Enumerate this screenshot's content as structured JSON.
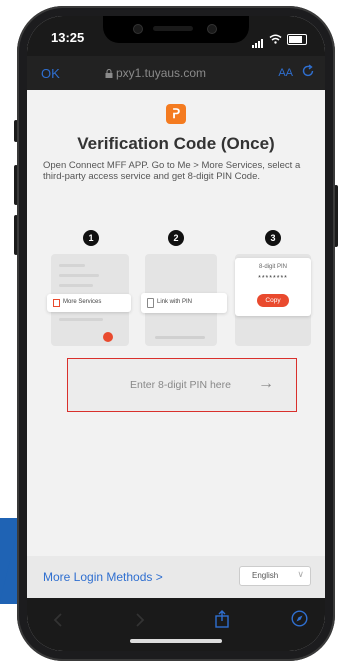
{
  "status_bar": {
    "time": "13:25"
  },
  "browser": {
    "left_label": "OK",
    "url": "pxy1.tuyaus.com",
    "text_size_label": "AA",
    "reload_icon": "reload-icon"
  },
  "page": {
    "logo_text": "ᕈ",
    "title": "Verification Code (Once)",
    "description": "Open Connect MFF APP. Go to Me > More Services, select a third-party access service and get 8-digit PIN Code.",
    "steps": [
      {
        "number": "1",
        "label": "More Services"
      },
      {
        "number": "2",
        "label": "Link with PIN"
      },
      {
        "number": "3",
        "label": "8-digit PIN",
        "value": "********",
        "button": "Copy"
      }
    ],
    "pin_input": {
      "placeholder": "Enter 8-digit PIN here",
      "arrow": "→"
    },
    "more_login": "More Login Methods >",
    "language": {
      "selected": "English",
      "chevron": "∨"
    }
  },
  "toolbar": {
    "back_icon": "back-icon",
    "forward_icon": "forward-icon",
    "share_icon": "share-icon",
    "compass_icon": "compass-icon"
  },
  "colors": {
    "accent": "#2f6fd0",
    "brand": "#f47b20",
    "highlight_border": "#d9302c",
    "copy_button": "#e94a2e"
  }
}
